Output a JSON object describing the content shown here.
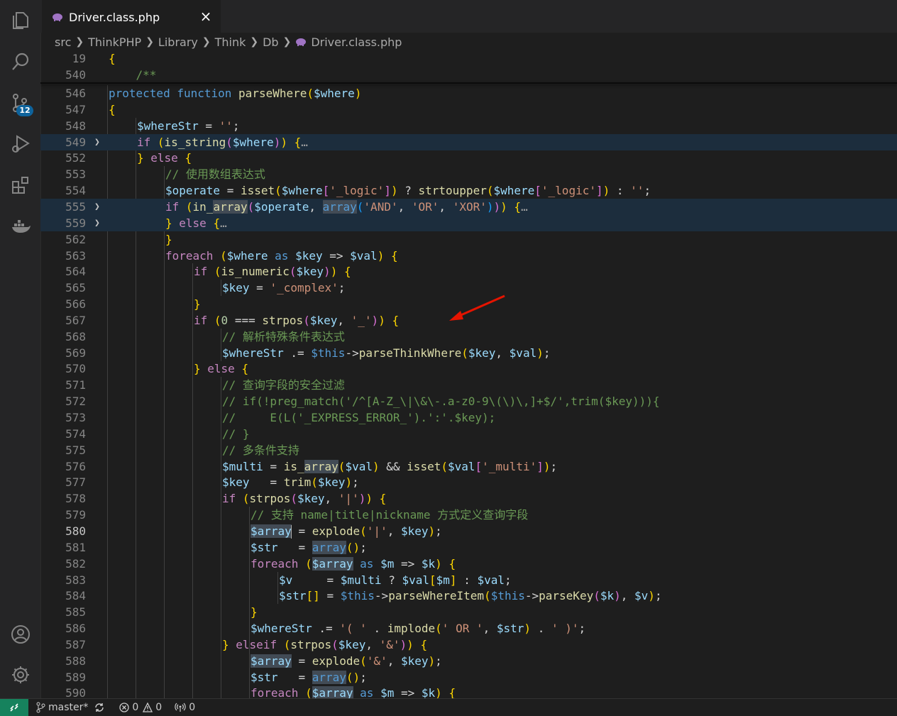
{
  "tab": {
    "filename": "Driver.class.php",
    "close_glyph": "×"
  },
  "breadcrumb": {
    "items": [
      "src",
      "ThinkPHP",
      "Library",
      "Think",
      "Db"
    ],
    "file": "Driver.class.php"
  },
  "activity": {
    "icons": [
      "explorer-icon",
      "search-icon",
      "source-control-icon",
      "run-debug-icon",
      "extensions-icon",
      "docker-icon",
      "account-icon",
      "settings-icon"
    ],
    "scm_badge": "12"
  },
  "sticky": [
    {
      "num": "19",
      "text": "{"
    },
    {
      "num": "540",
      "text": "    /**"
    }
  ],
  "lines": [
    {
      "num": "546",
      "text": "protected function parseWhere($where)"
    },
    {
      "num": "547",
      "text": "{"
    },
    {
      "num": "548",
      "text": "$whereStr = '';"
    },
    {
      "num": "549",
      "text": "if (is_string($where)) {…"
    },
    {
      "num": "552",
      "text": "} else {"
    },
    {
      "num": "553",
      "text": "// 使用数组表达式"
    },
    {
      "num": "554",
      "text": "$operate = isset($where['_logic']) ? strtoupper($where['_logic']) : '';"
    },
    {
      "num": "555",
      "text": "if (in_array($operate, array('AND', 'OR', 'XOR'))) {…"
    },
    {
      "num": "559",
      "text": "} else {…"
    },
    {
      "num": "562",
      "text": "}"
    },
    {
      "num": "563",
      "text": "foreach ($where as $key => $val) {"
    },
    {
      "num": "564",
      "text": "if (is_numeric($key)) {"
    },
    {
      "num": "565",
      "text": "$key = '_complex';"
    },
    {
      "num": "566",
      "text": "}"
    },
    {
      "num": "567",
      "text": "if (0 === strpos($key, '_')) {"
    },
    {
      "num": "568",
      "text": "// 解析特殊条件表达式"
    },
    {
      "num": "569",
      "text": "$whereStr .= $this->parseThinkWhere($key, $val);"
    },
    {
      "num": "570",
      "text": "} else {"
    },
    {
      "num": "571",
      "text": "// 查询字段的安全过滤"
    },
    {
      "num": "572",
      "text": "// if(!preg_match('/^[A-Z_\\|\\&\\-.a-z0-9\\(\\)\\,]+$/',trim($key))){"
    },
    {
      "num": "573",
      "text": "//     E(L('_EXPRESS_ERROR_').':'.$key);"
    },
    {
      "num": "574",
      "text": "// }"
    },
    {
      "num": "575",
      "text": "// 多条件支持"
    },
    {
      "num": "576",
      "text": "$multi = is_array($val) && isset($val['_multi']);"
    },
    {
      "num": "577",
      "text": "$key   = trim($key);"
    },
    {
      "num": "578",
      "text": "if (strpos($key, '|')) {"
    },
    {
      "num": "579",
      "text": "// 支持 name|title|nickname 方式定义查询字段"
    },
    {
      "num": "580",
      "text": "$array = explode('|', $key);"
    },
    {
      "num": "581",
      "text": "$str   = array();"
    },
    {
      "num": "582",
      "text": "foreach ($array as $m => $k) {"
    },
    {
      "num": "583",
      "text": "$v     = $multi ? $val[$m] : $val;"
    },
    {
      "num": "584",
      "text": "$str[] = $this->parseWhereItem($this->parseKey($k), $v);"
    },
    {
      "num": "585",
      "text": "}"
    },
    {
      "num": "586",
      "text": "$whereStr .= '( ' . implode(' OR ', $str) . ' )';"
    },
    {
      "num": "587",
      "text": "} elseif (strpos($key, '&')) {"
    },
    {
      "num": "588",
      "text": "$array = explode('&', $key);"
    },
    {
      "num": "589",
      "text": "$str   = array();"
    },
    {
      "num": "590",
      "text": "foreach ($array as $m => $k) {"
    }
  ],
  "status": {
    "branch": "master*",
    "errors": "0",
    "warnings": "0",
    "ports": "0"
  },
  "colors": {
    "keyword": "#569cd6",
    "control": "#c586c0",
    "function": "#dcdcaa",
    "variable": "#9cdcfe",
    "string": "#ce9178",
    "comment": "#6a9955",
    "arrow": "#e51400"
  }
}
